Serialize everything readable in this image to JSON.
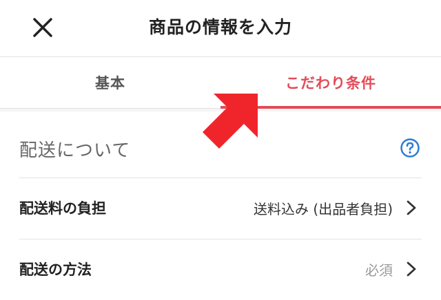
{
  "header": {
    "title": "商品の情報を入力"
  },
  "tabs": [
    {
      "label": "基本",
      "active": false
    },
    {
      "label": "こだわり条件",
      "active": true
    }
  ],
  "section": {
    "heading": "配送について",
    "rows": [
      {
        "label": "配送料の負担",
        "value": "送料込み (出品者負担)"
      },
      {
        "label": "配送の方法",
        "value": "必須"
      }
    ]
  },
  "colors": {
    "accent": "#e24b57",
    "help": "#2f7bd3",
    "arrow": "#f0252b"
  },
  "icons": {
    "close": "close-icon",
    "help": "help-circle-icon",
    "chevron": "chevron-right-icon",
    "pointer": "pointer-arrow-icon"
  }
}
